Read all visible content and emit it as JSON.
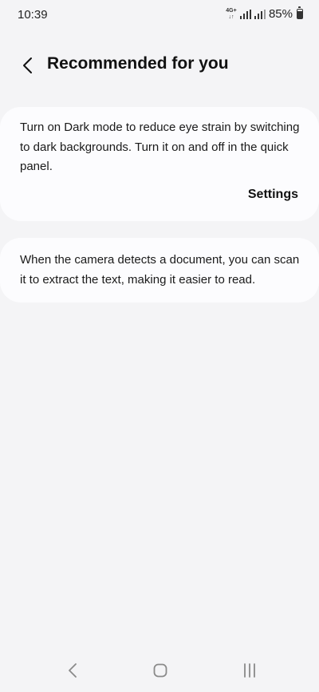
{
  "status_bar": {
    "time": "10:39",
    "network_top": "4G+",
    "network_bottom": "↓↑",
    "battery_percent": "85%",
    "battery_level": 0.85
  },
  "header": {
    "title": "Recommended for you"
  },
  "cards": [
    {
      "text": "Turn on Dark mode to reduce eye strain by switching to dark backgrounds. Turn it on and off in the quick panel.",
      "action_label": "Settings"
    },
    {
      "text": "When the camera detects a document, you can scan it to extract the text, making it easier to read."
    }
  ],
  "icons": {
    "back": "chevron-left-icon",
    "nav_back": "nav-back-icon",
    "nav_home": "nav-home-icon",
    "nav_recents": "nav-recents-icon"
  },
  "colors": {
    "background": "#f4f4f6",
    "card": "#fcfcfe",
    "text": "#111111"
  }
}
